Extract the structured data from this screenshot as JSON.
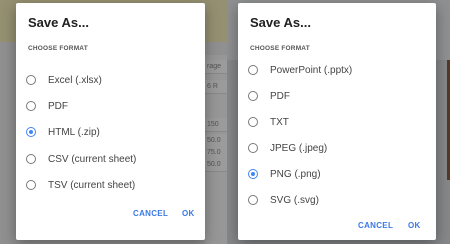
{
  "colors": {
    "accent": "#4285f4",
    "button_text": "#3b78e7",
    "scrim": "rgba(0,0,0,0.38)"
  },
  "left_dialog": {
    "title": "Save As...",
    "section_label": "CHOOSE FORMAT",
    "options": [
      {
        "label": "Excel (.xlsx)",
        "selected": false
      },
      {
        "label": "PDF",
        "selected": false
      },
      {
        "label": "HTML (.zip)",
        "selected": true
      },
      {
        "label": "CSV (current sheet)",
        "selected": false
      },
      {
        "label": "TSV (current sheet)",
        "selected": false
      }
    ],
    "cancel_label": "CANCEL",
    "ok_label": "OK"
  },
  "left_background": {
    "cells": [
      "rage",
      "6 R",
      "150",
      "50.0",
      "75.0",
      "50.0"
    ]
  },
  "right_dialog": {
    "title": "Save As...",
    "section_label": "CHOOSE FORMAT",
    "options": [
      {
        "label": "PowerPoint (.pptx)",
        "selected": false
      },
      {
        "label": "PDF",
        "selected": false
      },
      {
        "label": "TXT",
        "selected": false
      },
      {
        "label": "JPEG (.jpeg)",
        "selected": false
      },
      {
        "label": "PNG (.png)",
        "selected": true
      },
      {
        "label": "SVG (.svg)",
        "selected": false
      }
    ],
    "cancel_label": "CANCEL",
    "ok_label": "OK"
  }
}
